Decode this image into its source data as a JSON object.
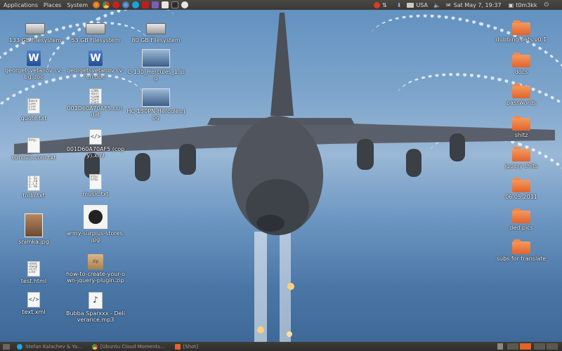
{
  "top_panel": {
    "menus": [
      "Applications",
      "Places",
      "System"
    ],
    "launchers": [
      "firefox-icon",
      "chrome-icon",
      "opera-icon",
      "thunderbird-icon",
      "skype-icon",
      "filezilla-icon",
      "pidgin-icon",
      "text-editor-icon",
      "terminal-icon",
      "screenshot-icon"
    ],
    "layout": "USA",
    "datetime": "Sat May 7, 19:37",
    "user": "t0m3kk"
  },
  "desktop": {
    "drives": [
      {
        "label": "133 GB Filesystem"
      },
      {
        "label": "53 GB Filesystem"
      },
      {
        "label": "80 GB Filesystem"
      }
    ],
    "left_icons": [
      {
        "label": "georgetsvetanov cv-bg.doc",
        "kind": "word"
      },
      {
        "label": "quote.txt",
        "kind": "text",
        "preview": "Dance Love. Live Live"
      },
      {
        "label": "edno23.com.txt",
        "kind": "text",
        "preview": "http:"
      },
      {
        "label": "todo.txt",
        "kind": "text",
        "preview": "1. Ex 2. Ed 2.1 E 3. Re"
      },
      {
        "label": "snimka.jpg",
        "kind": "photo"
      },
      {
        "label": "test.html",
        "kind": "text",
        "preview": "<html <head <titl </ht"
      },
      {
        "label": "text.xml",
        "kind": "xml"
      }
    ],
    "middle_icons": [
      {
        "label": "georgetsvetanov cv-en.doc",
        "kind": "word"
      },
      {
        "label": "001D60A70AF5.csn.dat",
        "kind": "text",
        "preview": "<CVM> <Entr <comm <Tent <Tent"
      },
      {
        "label": "001D60A70AF5 (copy).xml",
        "kind": "xml"
      },
      {
        "label": "music.txt",
        "kind": "text",
        "preview": "http: http:"
      },
      {
        "label": "army-surplus-stores.jpg",
        "kind": "photo2"
      },
      {
        "label": "how-to-create-your-own-jquery-plugin.zip",
        "kind": "zip"
      },
      {
        "label": "Bubba Sparxxx - Deliverance.mp3",
        "kind": "mp3"
      }
    ],
    "images": [
      {
        "label": "C-130_Hercules_1.jpg"
      },
      {
        "label": "HC-130PN-Hercules.jpg"
      }
    ],
    "folders": [
      {
        "label": "dubbing bets v0.1"
      },
      {
        "label": "docs"
      },
      {
        "label": "passwords"
      },
      {
        "label": "shitz"
      },
      {
        "label": "jquery shits"
      },
      {
        "label": "06.05.2011"
      },
      {
        "label": "ded pics"
      },
      {
        "label": "subs for translate"
      }
    ]
  },
  "bottom_panel": {
    "tasks": [
      {
        "label": "Stefan Kalachev & Ya..."
      },
      {
        "label": "[Ubuntu Cloud Moments..."
      },
      {
        "label": "[Shot]"
      }
    ]
  }
}
